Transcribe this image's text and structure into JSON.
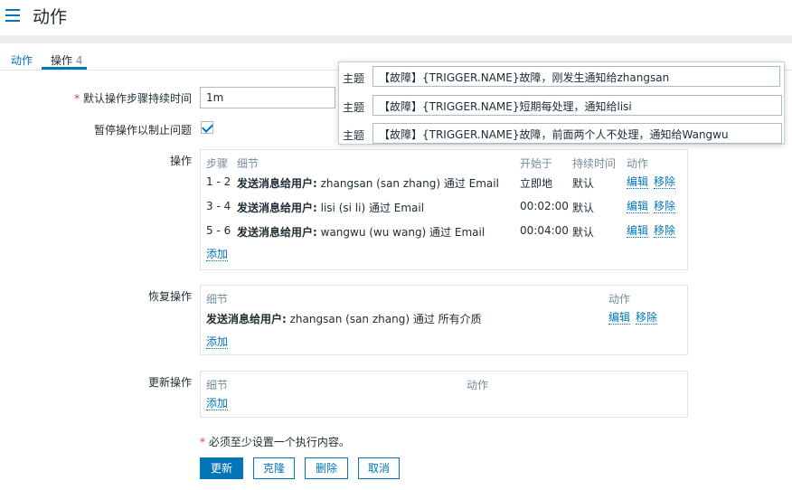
{
  "header": {
    "title": "动作"
  },
  "tabs": [
    {
      "label": "动作"
    },
    {
      "label": "操作",
      "count": "4"
    }
  ],
  "form": {
    "duration_label": "默认操作步骤持续时间",
    "duration_value": "1m",
    "pause_label": "暂停操作以制止问题",
    "pause_checked": true,
    "ops_label": "操作",
    "recovery_label": "恢复操作",
    "update_label": "更新操作",
    "required_note": "必须至少设置一个执行内容。"
  },
  "operations": {
    "headers": {
      "steps": "步骤",
      "details": "细节",
      "start": "开始于",
      "duration": "持续时间",
      "action": "动作"
    },
    "rows": [
      {
        "steps": "1 - 2",
        "detail_bold": "发送消息给用户:",
        "detail": " zhangsan (san zhang) 通过 Email",
        "start": "立即地",
        "duration": "默认",
        "edit": "编辑",
        "remove": "移除"
      },
      {
        "steps": "3 - 4",
        "detail_bold": "发送消息给用户:",
        "detail": " lisi (si li) 通过 Email",
        "start": "00:02:00",
        "duration": "默认",
        "edit": "编辑",
        "remove": "移除"
      },
      {
        "steps": "5 - 6",
        "detail_bold": "发送消息给用户:",
        "detail": " wangwu (wu wang) 通过 Email",
        "start": "00:04:00",
        "duration": "默认",
        "edit": "编辑",
        "remove": "移除"
      }
    ],
    "add": "添加"
  },
  "recovery": {
    "headers": {
      "details": "细节",
      "action": "动作"
    },
    "row": {
      "detail_bold": "发送消息给用户:",
      "detail": " zhangsan (san zhang) 通过 所有介质",
      "edit": "编辑",
      "remove": "移除"
    },
    "add": "添加"
  },
  "update": {
    "headers": {
      "details": "细节",
      "action": "动作"
    },
    "add": "添加"
  },
  "buttons": {
    "update": "更新",
    "clone": "克隆",
    "delete": "删除",
    "cancel": "取消"
  },
  "popup": {
    "rows": [
      {
        "label": "主题",
        "value": "【故障】{TRIGGER.NAME}故障，刚发生通知给zhangsan"
      },
      {
        "label": "主题",
        "value": "【故障】{TRIGGER.NAME}短期每处理，通知给lisi"
      },
      {
        "label": "主题",
        "value": "【故障】{TRIGGER.NAME}故障，前面两个人不处理，通知给Wangwu"
      }
    ]
  },
  "colors": {
    "accent": "#0275b8",
    "required": "#e33734"
  }
}
